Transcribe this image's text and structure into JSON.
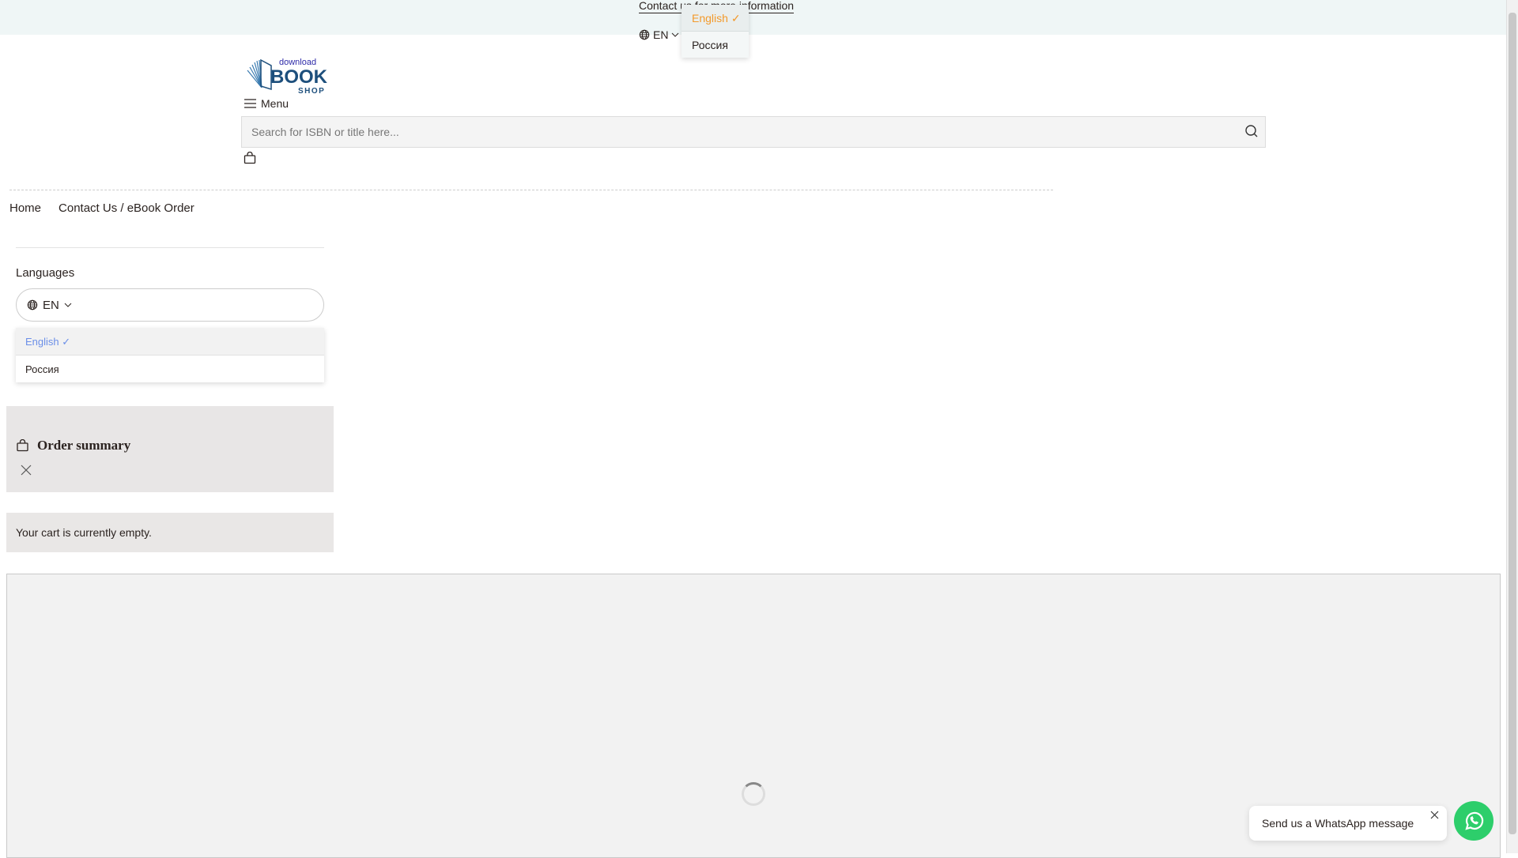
{
  "topbar": {
    "contact_link": "Contact us for more information",
    "lang_code": "EN",
    "lang_options": [
      {
        "label": "English",
        "selected": true
      },
      {
        "label": "Россия",
        "selected": false
      }
    ]
  },
  "logo": {
    "line1": "download",
    "line2": "BOOK",
    "line3": "SHOP"
  },
  "header": {
    "menu_label": "Menu",
    "search_placeholder": "Search for ISBN or title here..."
  },
  "breadcrumb": [
    {
      "label": "Home"
    },
    {
      "label": "Contact Us / eBook Order"
    }
  ],
  "sidebar": {
    "languages_label": "Languages",
    "lang_code": "EN",
    "lang_options": [
      {
        "label": "English",
        "selected": true
      },
      {
        "label": "Россия",
        "selected": false
      }
    ]
  },
  "order_summary": {
    "title": "Order summary",
    "empty_text": "Your cart is currently empty."
  },
  "whatsapp": {
    "message": "Send us a WhatsApp message"
  },
  "colors": {
    "accent_orange": "#f39a2b",
    "accent_blue": "#6b8fe8",
    "whatsapp_green": "#2dce6b",
    "logo_blue": "#1d4f7c"
  }
}
